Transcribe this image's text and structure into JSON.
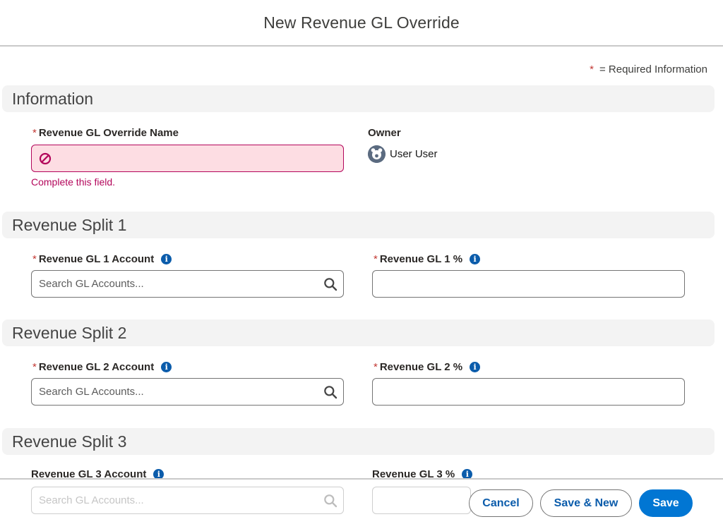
{
  "header": {
    "title": "New Revenue GL Override"
  },
  "required_legend": {
    "star": "*",
    "text": "= Required Information"
  },
  "sections": {
    "information": {
      "title": "Information",
      "name_field": {
        "required": "*",
        "label": "Revenue GL Override Name",
        "value": "",
        "error": "Complete this field."
      },
      "owner": {
        "label": "Owner",
        "value": "User User"
      }
    },
    "split1": {
      "title": "Revenue Split 1",
      "account": {
        "required": "*",
        "label": "Revenue GL 1 Account",
        "placeholder": "Search GL Accounts..."
      },
      "percent": {
        "required": "*",
        "label": "Revenue GL 1 %",
        "value": ""
      }
    },
    "split2": {
      "title": "Revenue Split 2",
      "account": {
        "required": "*",
        "label": "Revenue GL 2 Account",
        "placeholder": "Search GL Accounts..."
      },
      "percent": {
        "required": "*",
        "label": "Revenue GL 2 %",
        "value": ""
      }
    },
    "split3": {
      "title": "Revenue Split 3",
      "account": {
        "label": "Revenue GL 3 Account",
        "placeholder": "Search GL Accounts..."
      },
      "percent": {
        "label": "Revenue GL 3 %",
        "value": ""
      }
    }
  },
  "info_glyph": "i",
  "icons": {
    "error": "error-icon",
    "search": "search-icon",
    "info": "info-icon",
    "avatar": "user-avatar-icon"
  },
  "colors": {
    "brand": "#0176d3",
    "error": "#b3065b",
    "error_bg": "#fddde3",
    "required": "#c23934",
    "info": "#0b5cab"
  },
  "footer": {
    "cancel": "Cancel",
    "save_new": "Save & New",
    "save": "Save"
  }
}
